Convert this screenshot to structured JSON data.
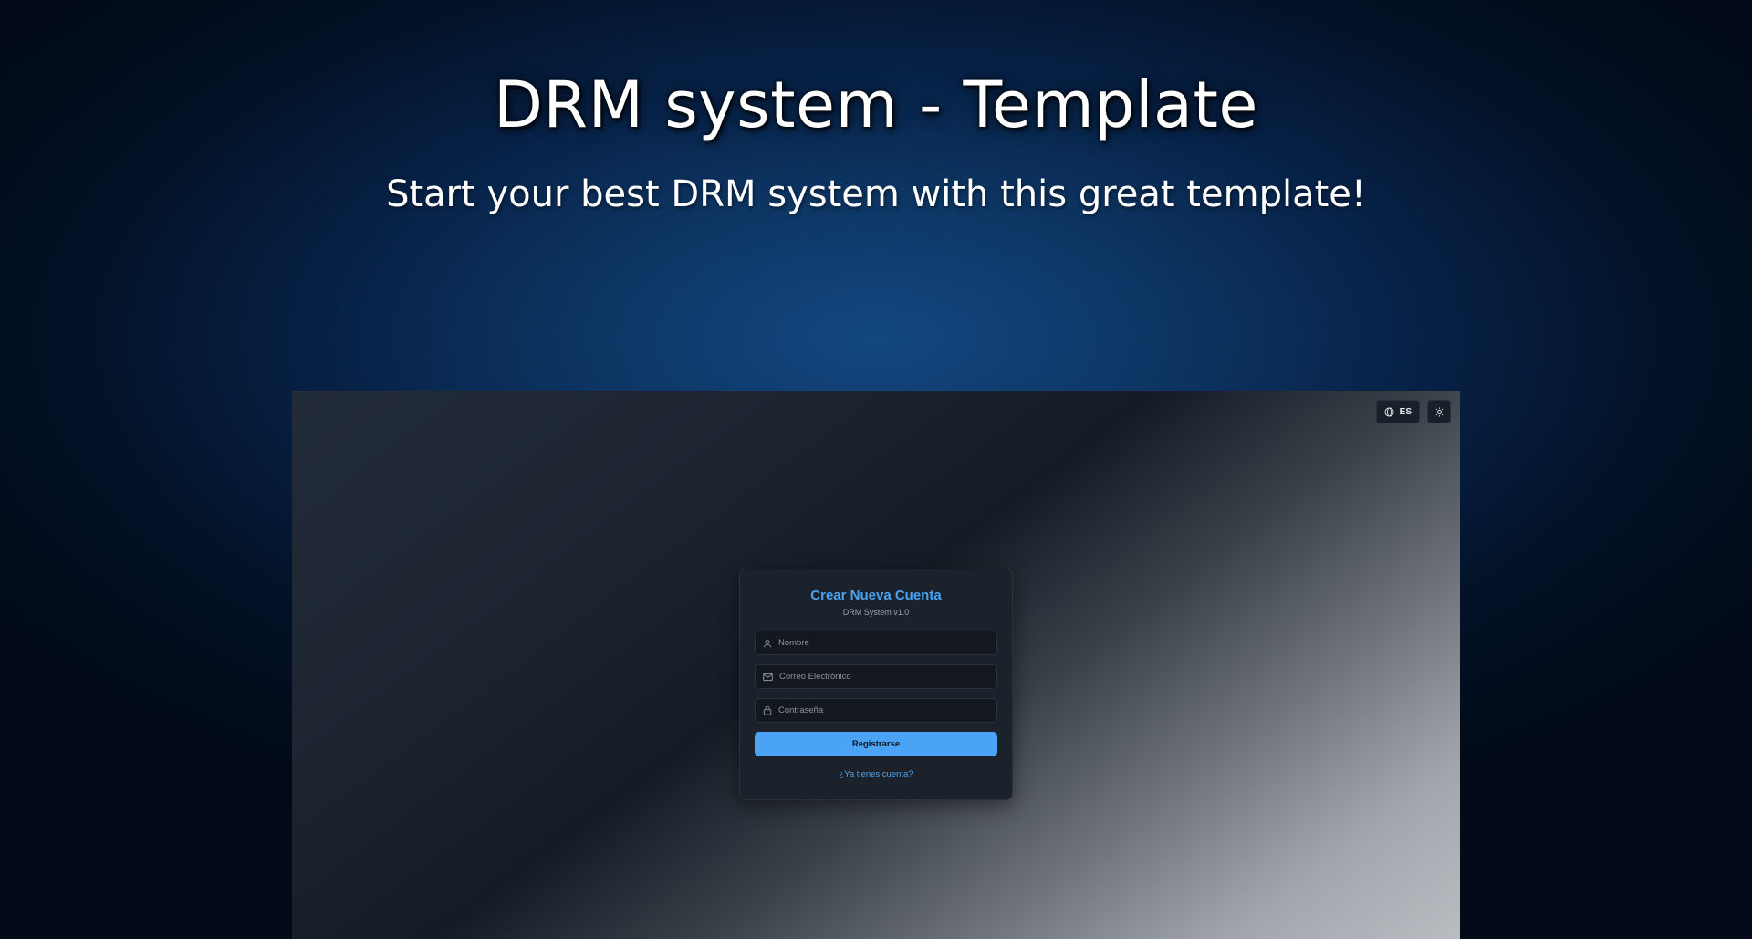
{
  "hero": {
    "title": "DRM system - Template",
    "subtitle": "Start your best DRM system with this great template!"
  },
  "preview": {
    "controls": {
      "language_label": "ES",
      "language_icon": "globe-icon",
      "theme_icon": "sun-icon"
    },
    "card": {
      "title": "Crear Nueva Cuenta",
      "version": "DRM System v1.0",
      "fields": {
        "name": {
          "placeholder": "Nombre",
          "icon": "user-icon"
        },
        "email": {
          "placeholder": "Correo Electrónico",
          "icon": "mail-icon"
        },
        "password": {
          "placeholder": "Contraseña",
          "icon": "lock-icon"
        }
      },
      "submit_label": "Registrarse",
      "login_link": "¿Ya tienes cuenta?"
    }
  },
  "colors": {
    "accent": "#4aa3f5",
    "card_bg": "#1c222b",
    "page_bg": "#072146"
  }
}
